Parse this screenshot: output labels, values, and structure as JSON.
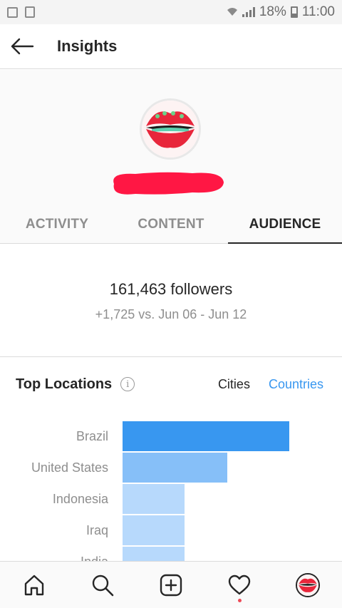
{
  "status_bar": {
    "battery": "18%",
    "time": "11:00",
    "icons": [
      "image-icon",
      "download-icon",
      "wifi-icon",
      "signal-icon",
      "battery-icon"
    ]
  },
  "header": {
    "title": "Insights",
    "back_icon": "arrow-left-icon"
  },
  "tabs": [
    {
      "label": "ACTIVITY",
      "active": false
    },
    {
      "label": "CONTENT",
      "active": false
    },
    {
      "label": "AUDIENCE",
      "active": true
    }
  ],
  "followers": {
    "count": "161,463 followers",
    "delta": "+1,725 vs. Jun 06 - Jun 12"
  },
  "top_locations": {
    "title": "Top Locations",
    "toggle": {
      "cities": "Cities",
      "countries": "Countries",
      "selected": "Countries"
    },
    "colors": {
      "accent": "#3897f0",
      "level1": "#3897f0",
      "level2": "#86bff8",
      "level3": "#b7d9fc"
    }
  },
  "chart_data": {
    "type": "bar",
    "orientation": "horizontal",
    "categories": [
      "Brazil",
      "United States",
      "Indonesia",
      "Iraq",
      "India"
    ],
    "values": [
      100,
      63,
      37,
      37,
      37
    ],
    "value_unit": "relative share (fraction of largest, estimated)"
  },
  "bottom_nav": [
    {
      "name": "home",
      "icon": "home-icon"
    },
    {
      "name": "search",
      "icon": "search-icon"
    },
    {
      "name": "new-post",
      "icon": "add-post-icon"
    },
    {
      "name": "activity",
      "icon": "heart-icon",
      "notification_dot": true
    },
    {
      "name": "profile",
      "icon": "profile-avatar"
    }
  ]
}
